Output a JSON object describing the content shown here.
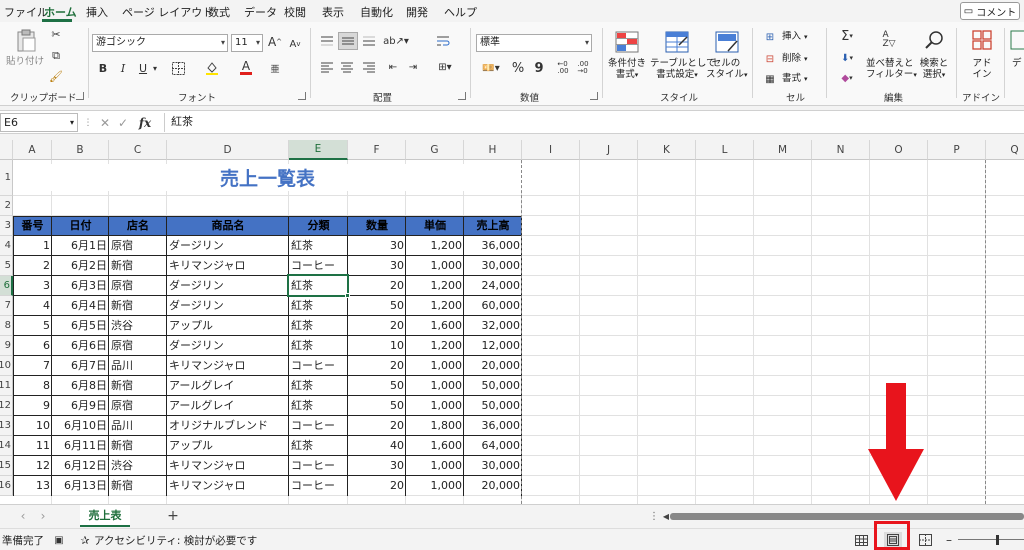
{
  "menu": {
    "items": [
      "ファイル",
      "ホーム",
      "挿入",
      "ページ レイアウト",
      "数式",
      "データ",
      "校閲",
      "表示",
      "自動化",
      "開発",
      "ヘルプ"
    ],
    "active": "ホーム",
    "comment_label": "コメント"
  },
  "ribbon": {
    "clipboard": {
      "paste": "貼り付け",
      "group": "クリップボード"
    },
    "font": {
      "name": "游ゴシック",
      "size": "11",
      "grow": "A",
      "shrink": "A",
      "bold": "B",
      "italic": "I",
      "underline": "U",
      "color_letter": "A",
      "group": "フォント"
    },
    "alignment": {
      "group": "配置"
    },
    "number": {
      "format": "標準",
      "percent": "%",
      "comma": "9",
      "group": "数値"
    },
    "styles": {
      "conditional": [
        "条件付き",
        "書式"
      ],
      "table": [
        "テーブルとして",
        "書式設定"
      ],
      "cell_style": [
        "セルの",
        "スタイル"
      ],
      "group": "スタイル"
    },
    "cells": {
      "insert": "挿入",
      "delete": "削除",
      "format": "書式",
      "group": "セル"
    },
    "editing": {
      "sigma": "Σ",
      "sort": [
        "並べ替えと",
        "フィルター"
      ],
      "find": [
        "検索と",
        "選択"
      ],
      "group": "編集"
    },
    "addins": {
      "label": [
        "アド",
        "イン"
      ],
      "group": "アドイン"
    },
    "extra": "デ"
  },
  "formula_bar": {
    "name_box": "E6",
    "fx": "fx",
    "content": "紅茶"
  },
  "columns": [
    "A",
    "B",
    "C",
    "D",
    "E",
    "F",
    "G",
    "H",
    "I",
    "J",
    "K",
    "L",
    "M",
    "N",
    "O",
    "P",
    "Q"
  ],
  "row_numbers": [
    "1",
    "2",
    "3",
    "4",
    "5",
    "6",
    "7",
    "8",
    "9",
    "10",
    "11",
    "12",
    "13",
    "14",
    "15",
    "16"
  ],
  "selected": {
    "column": "E",
    "row": "6"
  },
  "sheet": {
    "title": "売上一覧表",
    "headers": [
      "番号",
      "日付",
      "店名",
      "商品名",
      "分類",
      "数量",
      "単価",
      "売上高"
    ],
    "rows": [
      [
        "1",
        "6月1日",
        "原宿",
        "ダージリン",
        "紅茶",
        "30",
        "1,200",
        "36,000"
      ],
      [
        "2",
        "6月2日",
        "新宿",
        "キリマンジャロ",
        "コーヒー",
        "30",
        "1,000",
        "30,000"
      ],
      [
        "3",
        "6月3日",
        "原宿",
        "ダージリン",
        "紅茶",
        "20",
        "1,200",
        "24,000"
      ],
      [
        "4",
        "6月4日",
        "新宿",
        "ダージリン",
        "紅茶",
        "50",
        "1,200",
        "60,000"
      ],
      [
        "5",
        "6月5日",
        "渋谷",
        "アップル",
        "紅茶",
        "20",
        "1,600",
        "32,000"
      ],
      [
        "6",
        "6月6日",
        "原宿",
        "ダージリン",
        "紅茶",
        "10",
        "1,200",
        "12,000"
      ],
      [
        "7",
        "6月7日",
        "品川",
        "キリマンジャロ",
        "コーヒー",
        "20",
        "1,000",
        "20,000"
      ],
      [
        "8",
        "6月8日",
        "新宿",
        "アールグレイ",
        "紅茶",
        "50",
        "1,000",
        "50,000"
      ],
      [
        "9",
        "6月9日",
        "原宿",
        "アールグレイ",
        "紅茶",
        "50",
        "1,000",
        "50,000"
      ],
      [
        "10",
        "6月10日",
        "品川",
        "オリジナルブレンド",
        "コーヒー",
        "20",
        "1,800",
        "36,000"
      ],
      [
        "11",
        "6月11日",
        "新宿",
        "アップル",
        "紅茶",
        "40",
        "1,600",
        "64,000"
      ],
      [
        "12",
        "6月12日",
        "渋谷",
        "キリマンジャロ",
        "コーヒー",
        "30",
        "1,000",
        "30,000"
      ],
      [
        "13",
        "6月13日",
        "新宿",
        "キリマンジャロ",
        "コーヒー",
        "20",
        "1,000",
        "20,000"
      ]
    ]
  },
  "tabs": {
    "sheet_name": "売上表",
    "add": "+"
  },
  "status": {
    "ready": "準備完了",
    "accessibility": "アクセシビリティ: 検討が必要です",
    "view_normal": "normal-view-icon",
    "view_page_layout": "page-layout-view-icon",
    "view_page_break": "page-break-preview-icon"
  },
  "colors": {
    "accent": "#1e7145",
    "header_fill": "#4472c4",
    "title": "#4472c4",
    "highlight": "#e8141c"
  }
}
